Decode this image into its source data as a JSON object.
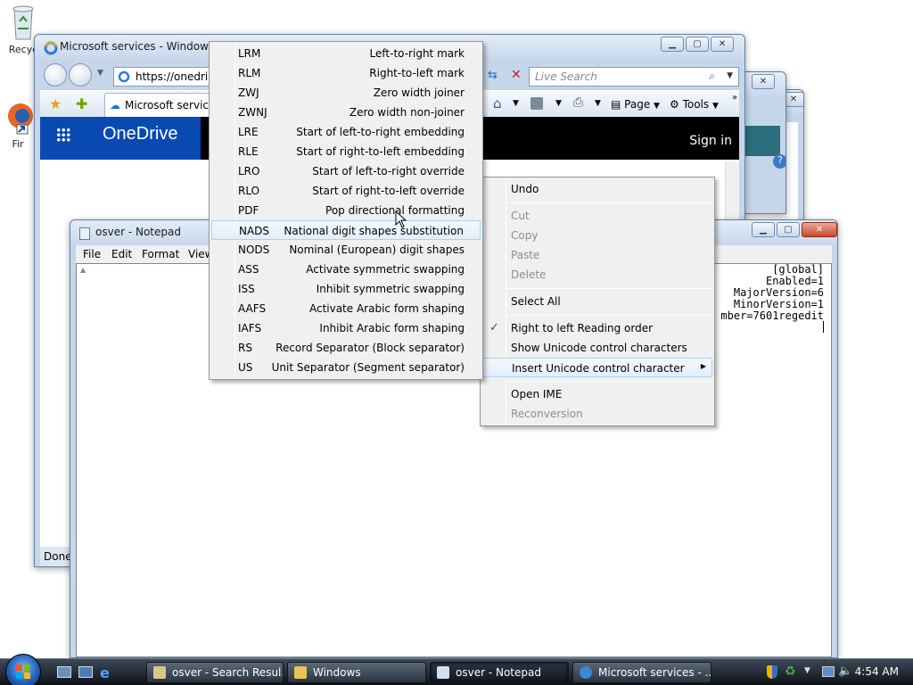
{
  "desktop": {
    "icons": [
      {
        "label": "Recyc",
        "icon": "recycle-bin-icon"
      },
      {
        "label": "Fir",
        "icon": "firefox-icon"
      }
    ]
  },
  "ie_window": {
    "title": "Microsoft services - Windows In",
    "address": "https://onedriv",
    "search_placeholder": "Live Search",
    "tab_title": "Microsoft services",
    "toolbar": {
      "page": "Page",
      "tools": "Tools"
    },
    "brand": "OneDrive",
    "sign_in": "Sign in",
    "status": "Done"
  },
  "notepad": {
    "title": "osver - Notepad",
    "menus": [
      "File",
      "Edit",
      "Format",
      "View"
    ],
    "lines": [
      "[global]",
      "Enabled=1",
      "MajorVersion=6",
      "MinorVersion=1",
      "mber=7601regedit"
    ]
  },
  "unicode_menu": {
    "items": [
      {
        "code": "LRM",
        "desc": "Left-to-right mark"
      },
      {
        "code": "RLM",
        "desc": "Right-to-left mark"
      },
      {
        "code": "ZWJ",
        "desc": "Zero width joiner"
      },
      {
        "code": "ZWNJ",
        "desc": "Zero width non-joiner"
      },
      {
        "code": "LRE",
        "desc": "Start of left-to-right embedding"
      },
      {
        "code": "RLE",
        "desc": "Start of right-to-left embedding"
      },
      {
        "code": "LRO",
        "desc": "Start of left-to-right override"
      },
      {
        "code": "RLO",
        "desc": "Start of right-to-left override"
      },
      {
        "code": "PDF",
        "desc": "Pop directional formatting"
      },
      {
        "code": "NADS",
        "desc": "National digit shapes substitution",
        "highlighted": true
      },
      {
        "code": "NODS",
        "desc": "Nominal (European) digit shapes"
      },
      {
        "code": "ASS",
        "desc": "Activate symmetric swapping"
      },
      {
        "code": "ISS",
        "desc": "Inhibit symmetric swapping"
      },
      {
        "code": "AAFS",
        "desc": "Activate Arabic form shaping"
      },
      {
        "code": "IAFS",
        "desc": "Inhibit Arabic form shaping"
      },
      {
        "code": "RS",
        "desc": "Record Separator (Block separator)"
      },
      {
        "code": "US",
        "desc": "Unit Separator (Segment separator)"
      }
    ]
  },
  "context_menu": {
    "undo": "Undo",
    "cut": "Cut",
    "copy": "Copy",
    "paste": "Paste",
    "delete": "Delete",
    "select_all": "Select All",
    "rtl": "Right to left Reading order",
    "rtl_checked": true,
    "show_unicode": "Show Unicode control characters",
    "insert_unicode": "Insert Unicode control character",
    "open_ime": "Open IME",
    "reconversion": "Reconversion"
  },
  "taskbar": {
    "buttons": [
      {
        "label": "osver - Search Resul...",
        "icon": "search-folder-icon"
      },
      {
        "label": "Windows",
        "icon": "folder-icon"
      },
      {
        "label": "osver - Notepad",
        "icon": "notepad-icon",
        "active": true
      },
      {
        "label": "Microsoft services - ...",
        "icon": "ie-icon"
      }
    ],
    "time": "4:54 AM"
  },
  "colors": {
    "onedrive_blue": "#094ab2",
    "accent": "#1f5fb8"
  }
}
